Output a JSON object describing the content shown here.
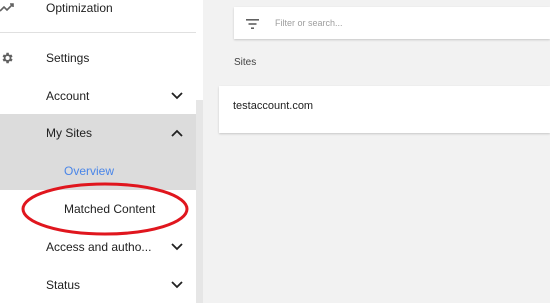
{
  "sidebar": {
    "items": [
      {
        "label": "Optimization",
        "icon": "trending-icon"
      },
      {
        "label": "Settings",
        "icon": "gear-icon"
      },
      {
        "label": "Account",
        "icon": "chevron-down-icon"
      },
      {
        "label": "My Sites",
        "icon": "chevron-up-icon"
      },
      {
        "label": "Overview"
      },
      {
        "label": "Matched Content"
      },
      {
        "label": "Access and autho...",
        "icon": "chevron-down-icon"
      },
      {
        "label": "Status",
        "icon": "chevron-down-icon"
      }
    ],
    "selected_item": "Overview",
    "highlight_color": "#e0161e"
  },
  "main": {
    "search": {
      "placeholder": "Filter or search...",
      "value": ""
    },
    "section_title": "Sites",
    "sites": [
      "testaccount.com"
    ]
  },
  "colors": {
    "accent": "#4a86e8",
    "selected_bg": "#dcdcdc",
    "page_bg": "#f2f2f2"
  }
}
